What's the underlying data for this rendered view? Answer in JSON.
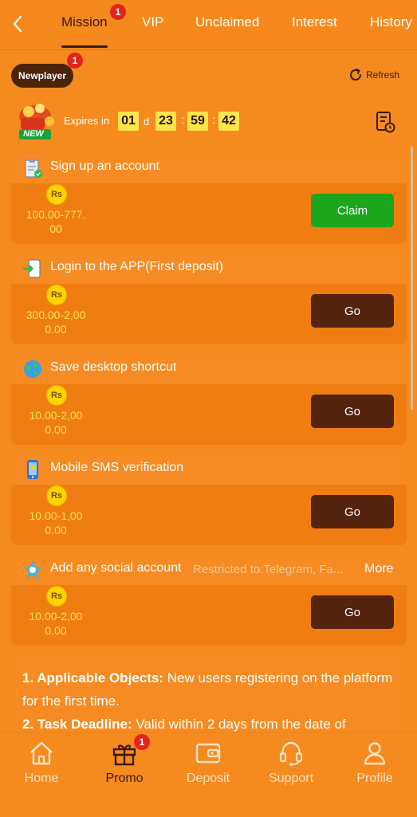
{
  "top_tabs": [
    {
      "label": "Mission",
      "badge": "1"
    },
    {
      "label": "VIP"
    },
    {
      "label": "Unclaimed"
    },
    {
      "label": "Interest"
    },
    {
      "label": "History"
    }
  ],
  "sub_tab": {
    "label": "Newplayer",
    "badge": "1"
  },
  "refresh_label": "Refresh",
  "new_badge": "NEW",
  "expires": {
    "label": "Expires in",
    "days": "01",
    "d_label": "d",
    "hours": "23",
    "minutes": "59",
    "seconds": "42",
    "sep": ":"
  },
  "currency": "Rs",
  "tasks": [
    {
      "title": "Sign up an account",
      "reward_line1": "100.00-777.",
      "reward_line2": "00",
      "action": "Claim"
    },
    {
      "title": "Login to the APP(First deposit)",
      "reward_line1": "300.00-2,00",
      "reward_line2": "0.00",
      "action": "Go"
    },
    {
      "title": "Save desktop shortcut",
      "reward_line1": "10.00-2,00",
      "reward_line2": "0.00",
      "action": "Go"
    },
    {
      "title": "Mobile SMS verification",
      "reward_line1": "10.00-1,00",
      "reward_line2": "0.00",
      "action": "Go"
    },
    {
      "title": "Add any social account",
      "restriction": "Restricted to:Telegram, Fa...",
      "more": "More",
      "reward_line1": "10.00-2,00",
      "reward_line2": "0.00",
      "action": "Go"
    }
  ],
  "rules": [
    {
      "heading": "1. Applicable Objects:",
      "text": " New users registering on the platform for the first time."
    },
    {
      "heading": "2. Task Deadline:",
      "text": " Valid within 2 days from the date of"
    }
  ],
  "bottom_nav": [
    {
      "label": "Home",
      "icon": "home-icon"
    },
    {
      "label": "Promo",
      "icon": "gift-icon",
      "badge": "1"
    },
    {
      "label": "Deposit",
      "icon": "wallet-icon"
    },
    {
      "label": "Support",
      "icon": "headset-icon"
    },
    {
      "label": "Profile",
      "icon": "profile-icon"
    }
  ]
}
